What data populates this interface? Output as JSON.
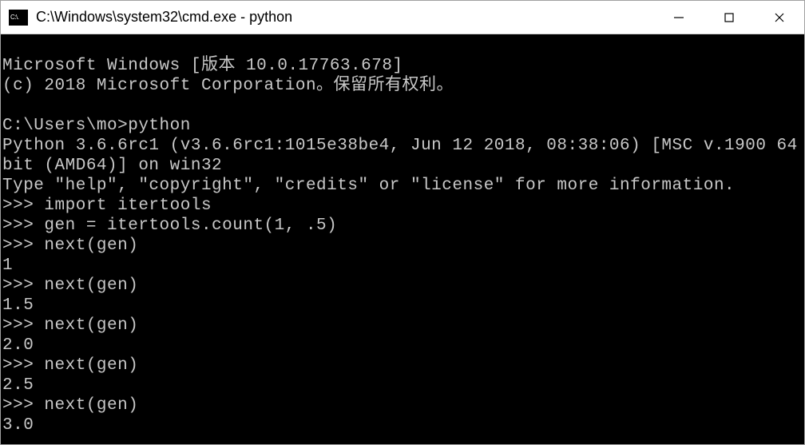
{
  "titlebar": {
    "icon_text": "C:\\.",
    "title": "C:\\Windows\\system32\\cmd.exe - python"
  },
  "terminal": {
    "lines": [
      "Microsoft Windows [版本 10.0.17763.678]",
      "(c) 2018 Microsoft Corporation。保留所有权利。",
      "",
      "C:\\Users\\mo>python",
      "Python 3.6.6rc1 (v3.6.6rc1:1015e38be4, Jun 12 2018, 08:38:06) [MSC v.1900 64 bit (AMD64)] on win32",
      "Type \"help\", \"copyright\", \"credits\" or \"license\" for more information.",
      ">>> import itertools",
      ">>> gen = itertools.count(1, .5)",
      ">>> next(gen)",
      "1",
      ">>> next(gen)",
      "1.5",
      ">>> next(gen)",
      "2.0",
      ">>> next(gen)",
      "2.5",
      ">>> next(gen)",
      "3.0"
    ]
  }
}
